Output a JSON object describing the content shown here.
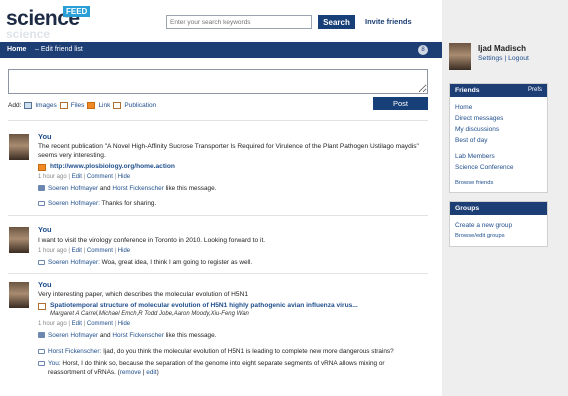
{
  "logo": {
    "word": "science",
    "badge": "FEED",
    "shadow": "science"
  },
  "search": {
    "placeholder": "Enter your search keywords",
    "button": "Search"
  },
  "header": {
    "invite": "Invite friends"
  },
  "topbar": {
    "home": "Home",
    "edit": "–  Edit friend list",
    "badge": "8"
  },
  "composer": {
    "add_label": "Add:",
    "attachments": [
      "Images",
      "Files",
      "Link",
      "Publication"
    ],
    "post": "Post"
  },
  "feed": [
    {
      "author": "You",
      "lines": [
        "The recent publication \"A Novel High-Affinity Sucrose Transporter Is Required for Virulence of the Plant Pathogen Ustilago maydis\"",
        "seems very interesting."
      ],
      "link": "http://www.plosbiology.org/home.action",
      "time": "1 hour ago",
      "actions": [
        "Edit",
        "Comment",
        "Hide"
      ],
      "likes": {
        "a": "Soeren Hofmayer",
        "and": "and",
        "b": "Horst Fickenscher",
        "rest": "like this message."
      },
      "comments": [
        {
          "author": "Soeren Hofmayer:",
          "text": "Thanks for sharing."
        }
      ]
    },
    {
      "author": "You",
      "lines": [
        "I want to visit the virology conference in Toronto in 2010. Looking forward to it."
      ],
      "time": "1 hour ago",
      "actions": [
        "Edit",
        "Comment",
        "Hide"
      ],
      "comments": [
        {
          "author": "Soeren Hofmayer:",
          "text": "Woa, great idea, I think I am going to register as well."
        }
      ]
    },
    {
      "author": "You",
      "lines": [
        "Very interesting paper, which describes the molecular evolution of H5N1"
      ],
      "paper_title": "Spatiotemporal structure of molecular evolution of H5N1 highly pathogenic avian influenza virus...",
      "paper_authors": "Margaret A Carrel,Michael Emch,R Todd Jobe,Aaron Moody,Xiu-Feng Wan",
      "time": "1 hour ago",
      "actions": [
        "Edit",
        "Comment",
        "Hide"
      ],
      "likes": {
        "a": "Soeren Hofmayer",
        "and": "and",
        "b": "Horst Fickenscher",
        "rest": "like this message."
      },
      "comments": [
        {
          "author": "Horst Fickenscher:",
          "text": "Ijad, do you think the molecular evolution of H5N1 is leading to complete new more dangerous strains?"
        },
        {
          "author": "You:",
          "text": "Horst, I do think so, because the separation of the genome into eight separate segments of vRNA allows mixing or",
          "text2": "reassortment of vRNAs.",
          "remove": "remove",
          "edit": "edit"
        }
      ]
    }
  ],
  "profile": {
    "name": "Ijad Madisch",
    "settings": "Settings",
    "sep": "|",
    "logout": "Logout"
  },
  "friends_panel": {
    "title": "Friends",
    "prefs": "Prefs",
    "items": [
      "Home",
      "Direct messages",
      "My discussions",
      "Best of day"
    ],
    "items2": [
      "Lab Members",
      "Science Conference"
    ],
    "browse": "Browse friends"
  },
  "groups_panel": {
    "title": "Groups",
    "create": "Create a new group",
    "browse": "Browse/edit groups"
  }
}
